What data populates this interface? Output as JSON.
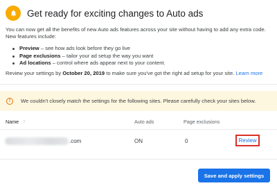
{
  "header": {
    "title": "Get ready for exciting changes to Auto ads",
    "icon": "bell-icon",
    "icon_color": "#f9ab00"
  },
  "intro": {
    "text": "You can now get all the benefits of new Auto ads features across your site without having to add any extra code. New features include:"
  },
  "features": [
    {
      "term": "Preview",
      "desc": " – see how ads look before they go live"
    },
    {
      "term": "Page exclusions",
      "desc": " – tailor your ad setup the way you want"
    },
    {
      "term": "Ad locations",
      "desc": " – control where ads appear next to your content."
    }
  ],
  "review_notice": {
    "before": "Review your settings by ",
    "date": "October 20, 2019",
    "after": " to make sure you've got the right ad setup for your site. ",
    "link": "Learn more"
  },
  "warning": {
    "icon": "warning-circle-icon",
    "text": "We couldn't closely match the settings for the following sites. Please carefully check your sites below.",
    "bg_color": "#fef7e0"
  },
  "table": {
    "columns": {
      "name": "Name",
      "name_sort_icon": "arrow-up-icon",
      "auto_ads": "Auto ads",
      "page_exclusions": "Page exclusions"
    },
    "rows": [
      {
        "site_suffix": ".com",
        "auto_ads": "ON",
        "page_exclusions": "0",
        "action": "Review"
      }
    ]
  },
  "footer": {
    "save_label": "Save and apply settings",
    "accent": "#1a73e8"
  }
}
